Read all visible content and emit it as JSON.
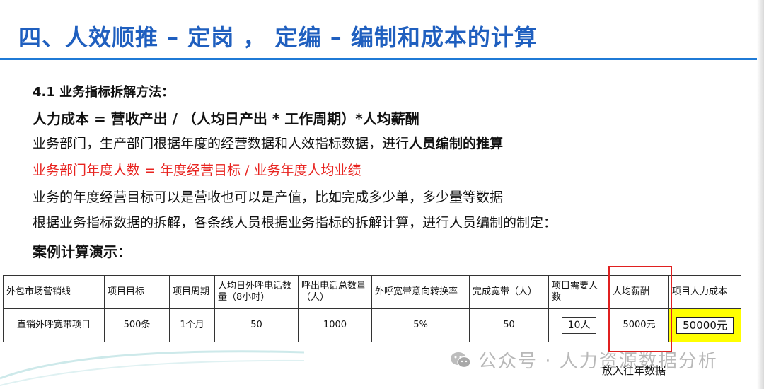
{
  "header": {
    "title": "四、人效顺推 – 定岗 ， 定编 – 编制和成本的计算"
  },
  "body": {
    "section_heading": "4.1  业务指标拆解方法：",
    "formula_cost": "人力成本 = 营收产出  /  （人均日产出 * 工作周期）*人均薪酬",
    "para1_prefix": "业务部门，生产部门根据年度的经营数据和人效指标数据，进行",
    "para1_bold": "人员编制的推算",
    "formula_headcount": "业务部门年度人数 = 年度经营目标 / 业务年度人均业绩",
    "para2": "业务的年度经营目标可以是营收也可以是产值，比如完成多少单，多少量等数据",
    "para3": "根据业务指标数据的拆解，各条线人员根据业务指标的拆解计算，进行人员编制的制定：",
    "case_heading": "案例计算演示："
  },
  "table": {
    "headers": [
      "外包市场营销线",
      "项目目标",
      "项目周期",
      "人均日外呼电话数量（8小时）",
      "呼出电话总数量（人）",
      "外呼宽带意向转换率",
      "完成宽带（人）",
      "项目需要人数",
      "人均薪酬",
      "项目人力成本"
    ],
    "row": [
      "直销外呼宽带项目",
      "500条",
      "1个月",
      "50",
      "1000",
      "5%",
      "50",
      "10人",
      "5000元",
      "50000元"
    ]
  },
  "annotation": {
    "note": "放入往年数据"
  },
  "watermark": {
    "text": "公众号 · 人力资源数据分析"
  },
  "colors": {
    "title": "#1f5fbf",
    "rule": "#1f7ad6",
    "red_text": "#e8231f",
    "highlight_box": "#e02020",
    "highlight_fill": "#ffff00"
  },
  "icons": {
    "watermark": "wechat-icon"
  }
}
